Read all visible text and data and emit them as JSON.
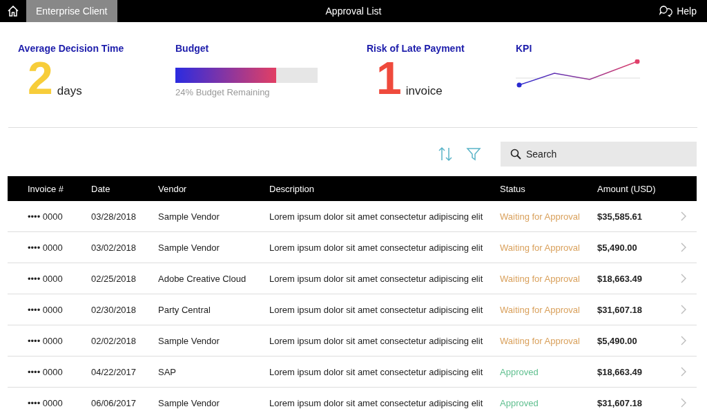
{
  "top_bar": {
    "tab": {
      "label": "Enterprise Client",
      "selected": true
    },
    "title": "Approval List",
    "help": "Help"
  },
  "stats": {
    "decision": {
      "title": "Average Decision Time",
      "value": "2",
      "unit": "days"
    },
    "budget": {
      "title": "Budget",
      "level": 0.71,
      "caption": "24% Budget Remaining"
    },
    "risk": {
      "title": "Risk of Late Payment",
      "value": "1",
      "unit": "invoice"
    },
    "kpi": {
      "title": "KPI"
    }
  },
  "search": {
    "placeholder": "Search"
  },
  "table": {
    "columns": [
      "Invoice #",
      "Date",
      "Vendor",
      "Description",
      "Status",
      "Amount (USD)"
    ],
    "rows": [
      {
        "invoice": "•••• 0000",
        "date": "03/28/2018",
        "vendor": "Sample Vendor",
        "description": "Lorem ipsum dolor sit amet consectetur adipiscing elit",
        "status": "Waiting for Approval",
        "kind": "waiting",
        "amount": "$35,585.61"
      },
      {
        "invoice": "•••• 0000",
        "date": "03/02/2018",
        "vendor": "Sample Vendor",
        "description": "Lorem ipsum dolor sit amet consectetur adipiscing elit",
        "status": "Waiting for Approval",
        "kind": "waiting",
        "amount": "$5,490.00"
      },
      {
        "invoice": "•••• 0000",
        "date": "02/25/2018",
        "vendor": "Adobe Creative Cloud",
        "description": "Lorem ipsum dolor sit amet consectetur adipiscing elit",
        "status": "Waiting for Approval",
        "kind": "waiting",
        "amount": "$18,663.49"
      },
      {
        "invoice": "•••• 0000",
        "date": "02/30/2018",
        "vendor": "Party Central",
        "description": "Lorem ipsum dolor sit amet consectetur adipiscing elit",
        "status": "Waiting for Approval",
        "kind": "waiting",
        "amount": "$31,607.18"
      },
      {
        "invoice": "•••• 0000",
        "date": "02/02/2018",
        "vendor": "Sample Vendor",
        "description": "Lorem ipsum dolor sit amet consectetur adipiscing elit",
        "status": "Waiting for Approval",
        "kind": "waiting",
        "amount": "$5,490.00"
      },
      {
        "invoice": "•••• 0000",
        "date": "04/22/2017",
        "vendor": "SAP",
        "description": "Lorem ipsum dolor sit amet consectetur adipiscing elit",
        "status": "Approved",
        "kind": "approved",
        "amount": "$18,663.49"
      },
      {
        "invoice": "•••• 0000",
        "date": "06/06/2017",
        "vendor": "Sample Vendor",
        "description": "Lorem ipsum dolor sit amet consectetur adipiscing elit",
        "status": "Approved",
        "kind": "approved",
        "amount": "$31,607.18"
      }
    ]
  }
}
